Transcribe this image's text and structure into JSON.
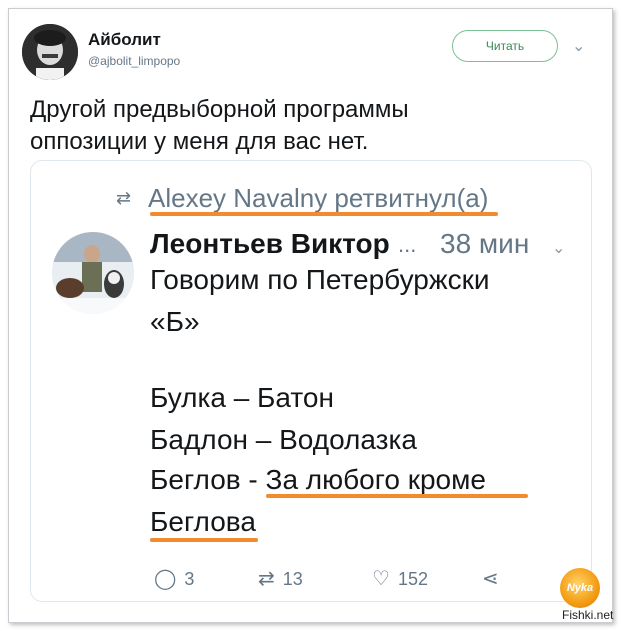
{
  "author": {
    "name": "Айболит",
    "handle": "@ajbolit_limpopo",
    "follow_label": "Читать"
  },
  "tweet": {
    "text_line1": "Другой предвыборной программы",
    "text_line2": "оппозиции у меня для вас нет."
  },
  "quoted": {
    "retweet_label": "Alexey Navalny ретвитнул(а)",
    "name": "Леонтьев Виктор",
    "dots": "...",
    "time": "38 мин",
    "lines": [
      "Говорим по Петербуржски",
      "«Б»",
      "Булка – Батон",
      "Бадлон – Водолазка",
      "Беглов - За любого кроме",
      "Беглова"
    ]
  },
  "actions": {
    "replies": "3",
    "retweets": "13",
    "likes": "152"
  },
  "watermark": {
    "logo_text": "Nyka",
    "site": "Fishki.net"
  },
  "colors": {
    "underline": "#f28a2e",
    "follow_border": "#7dbf96",
    "secondary_text": "#657786"
  }
}
